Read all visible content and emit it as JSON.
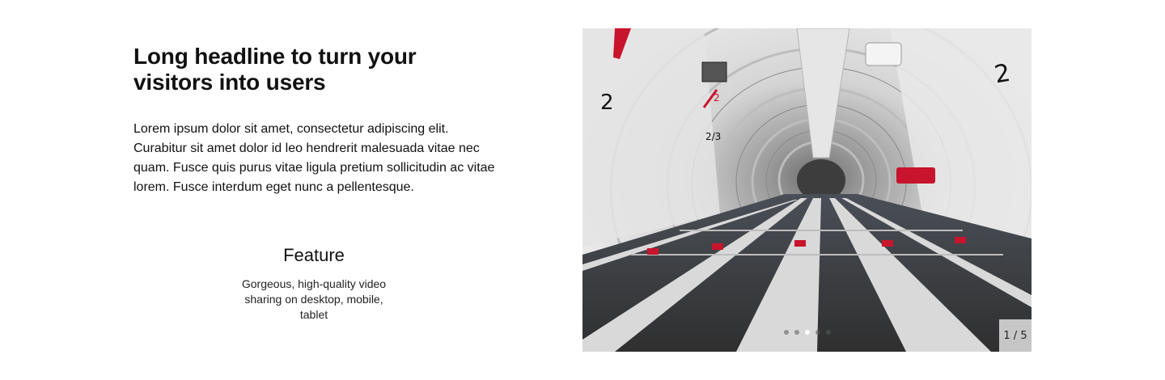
{
  "hero": {
    "headline": "Long headline to turn your visitors into users",
    "body": "Lorem ipsum dolor sit amet, consectetur adipiscing elit. Curabitur sit amet dolor id leo hendrerit malesuada vitae nec quam. Fusce quis purus vitae ligula pretium sollicitudin ac vitae lorem. Fusce interdum eget nunc a pellentesque."
  },
  "feature": {
    "title": "Feature",
    "description": "Gorgeous, high-quality video sharing on desktop, mobile, tablet"
  },
  "carousel": {
    "slide_counter": "1 / 5",
    "current_slide": 1,
    "total_slides": 5,
    "active_dot": 3,
    "slide_image": "cargo-aircraft-hold-photo",
    "fuselage_markings": [
      "2",
      "2",
      "2",
      "2/3"
    ],
    "colors": {
      "accent_red": "#c8142c",
      "floor": "#3a3a3a",
      "rail": "#d9d9d9"
    }
  }
}
